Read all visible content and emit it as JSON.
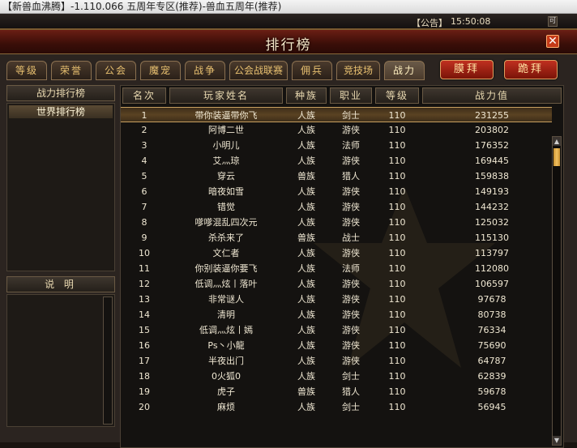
{
  "window": {
    "title": "【新兽血沸腾】-1.110.066 五周年专区(推荐)-兽血五周年(推荐)",
    "notice": "【公告】",
    "clock": "15:50:08",
    "mini_label": "可"
  },
  "panel": {
    "title": "排行榜",
    "close_label": "✕"
  },
  "tabs": [
    {
      "label": "等级"
    },
    {
      "label": "荣誉"
    },
    {
      "label": "公会"
    },
    {
      "label": "魔宠"
    },
    {
      "label": "战争"
    },
    {
      "label": "公会战联赛"
    },
    {
      "label": "佣兵"
    },
    {
      "label": "竞技场"
    },
    {
      "label": "战力"
    }
  ],
  "buttons": {
    "worship": "膜拜",
    "kneel": "跪拜"
  },
  "left": {
    "header": "战力排行榜",
    "items": [
      {
        "label": "世界排行榜"
      }
    ],
    "desc_header": "说  明"
  },
  "columns": {
    "rank": "名次",
    "name": "玩家姓名",
    "race": "种族",
    "job": "职业",
    "level": "等级",
    "power": "战力值"
  },
  "rows": [
    {
      "rank": "1",
      "name": "带你装逼带你飞",
      "race": "人族",
      "job": "剑士",
      "level": "110",
      "power": "231255"
    },
    {
      "rank": "2",
      "name": "阿博二世",
      "race": "人族",
      "job": "游侠",
      "level": "110",
      "power": "203802"
    },
    {
      "rank": "3",
      "name": "小明儿",
      "race": "人族",
      "job": "法师",
      "level": "110",
      "power": "176352"
    },
    {
      "rank": "4",
      "name": "艾灬琼",
      "race": "人族",
      "job": "游侠",
      "level": "110",
      "power": "169445"
    },
    {
      "rank": "5",
      "name": "穿云",
      "race": "兽族",
      "job": "猎人",
      "level": "110",
      "power": "159838"
    },
    {
      "rank": "6",
      "name": "暗夜如雪",
      "race": "人族",
      "job": "游侠",
      "level": "110",
      "power": "149193"
    },
    {
      "rank": "7",
      "name": "错觉",
      "race": "人族",
      "job": "游侠",
      "level": "110",
      "power": "144232"
    },
    {
      "rank": "8",
      "name": "嗲嗲混乱四次元",
      "race": "人族",
      "job": "游侠",
      "level": "110",
      "power": "125032"
    },
    {
      "rank": "9",
      "name": "杀杀来了",
      "race": "兽族",
      "job": "战士",
      "level": "110",
      "power": "115130"
    },
    {
      "rank": "10",
      "name": "文仁者",
      "race": "人族",
      "job": "游侠",
      "level": "110",
      "power": "113797"
    },
    {
      "rank": "11",
      "name": "你别装逼你要飞",
      "race": "人族",
      "job": "法师",
      "level": "110",
      "power": "112080"
    },
    {
      "rank": "12",
      "name": "低调灬炫丨落叶",
      "race": "人族",
      "job": "游侠",
      "level": "110",
      "power": "106597"
    },
    {
      "rank": "13",
      "name": "非常谜人",
      "race": "人族",
      "job": "游侠",
      "level": "110",
      "power": "97678"
    },
    {
      "rank": "14",
      "name": "清明",
      "race": "人族",
      "job": "游侠",
      "level": "110",
      "power": "80738"
    },
    {
      "rank": "15",
      "name": "低调灬炫丨嫣",
      "race": "人族",
      "job": "游侠",
      "level": "110",
      "power": "76334"
    },
    {
      "rank": "16",
      "name": "Ps丶小龍",
      "race": "人族",
      "job": "游侠",
      "level": "110",
      "power": "75690"
    },
    {
      "rank": "17",
      "name": "半夜出门",
      "race": "人族",
      "job": "游侠",
      "level": "110",
      "power": "64787"
    },
    {
      "rank": "18",
      "name": "0火狐0",
      "race": "人族",
      "job": "剑士",
      "level": "110",
      "power": "62839"
    },
    {
      "rank": "19",
      "name": "虎子",
      "race": "兽族",
      "job": "猎人",
      "level": "110",
      "power": "59678"
    },
    {
      "rank": "20",
      "name": "麻烦",
      "race": "人族",
      "job": "剑士",
      "level": "110",
      "power": "56945"
    }
  ],
  "scroll": {
    "up": "▲",
    "down": "▼"
  }
}
